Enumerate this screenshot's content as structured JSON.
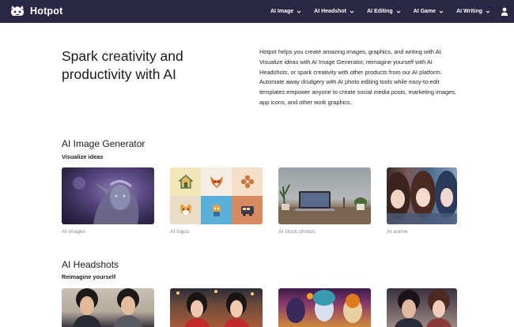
{
  "brand": {
    "name": "Hotpot"
  },
  "nav": {
    "items": [
      {
        "label": "AI Image"
      },
      {
        "label": "AI Headshot"
      },
      {
        "label": "AI Editing"
      },
      {
        "label": "AI Game"
      },
      {
        "label": "AI Writing"
      }
    ]
  },
  "hero": {
    "title": "Spark creativity and productivity with AI",
    "description": "Hotpot helps you create amazing images, graphics, and writing with AI. Visualize ideas with AI Image Generator, reimagine yourself with AI Headshots, or spark creativity with other products from our AI platform. Automate away drudgery with AI photo editing tools while easy-to-edit templates empower anyone to create social media posts, marketing images, app icons, and other work graphics."
  },
  "sections": [
    {
      "title": "AI Image Generator",
      "subtitle": "Visualize ideas",
      "cards": [
        {
          "label": "AI images"
        },
        {
          "label": "AI logos"
        },
        {
          "label": "AI stock photos"
        },
        {
          "label": "AI anime"
        }
      ]
    },
    {
      "title": "AI Headshots",
      "subtitle": "Reimagine yourself",
      "cards": []
    }
  ],
  "colors": {
    "nav_bg": "#2a2744",
    "accent": "#2a2744"
  }
}
